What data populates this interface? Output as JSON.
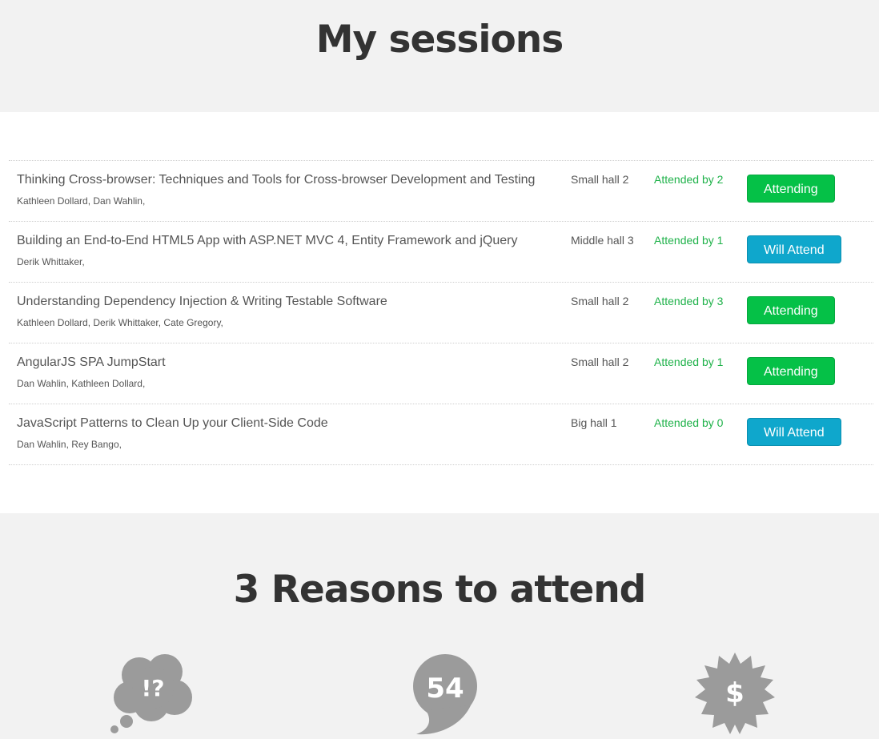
{
  "header": {
    "title": "My sessions"
  },
  "sessions": [
    {
      "title": "Thinking Cross-browser: Techniques and Tools for Cross-browser Development and Testing",
      "speakers": "Kathleen Dollard, Dan Wahlin,",
      "hall": "Small hall 2",
      "attendees": "Attended by 2",
      "button": "Attending",
      "status": "attending"
    },
    {
      "title": "Building an End-to-End HTML5 App with ASP.NET MVC 4, Entity Framework and jQuery",
      "speakers": "Derik Whittaker,",
      "hall": "Middle hall 3",
      "attendees": "Attended by 1",
      "button": "Will Attend",
      "status": "will-attend"
    },
    {
      "title": "Understanding Dependency Injection & Writing Testable Software",
      "speakers": "Kathleen Dollard, Derik Whittaker, Cate Gregory,",
      "hall": "Small hall 2",
      "attendees": "Attended by 3",
      "button": "Attending",
      "status": "attending"
    },
    {
      "title": "AngularJS SPA JumpStart",
      "speakers": "Dan Wahlin, Kathleen Dollard,",
      "hall": "Small hall 2",
      "attendees": "Attended by 1",
      "button": "Attending",
      "status": "attending"
    },
    {
      "title": "JavaScript Patterns to Clean Up your Client-Side Code",
      "speakers": "Dan Wahlin, Rey Bango,",
      "hall": "Big hall 1",
      "attendees": "Attended by 0",
      "button": "Will Attend",
      "status": "will-attend"
    }
  ],
  "reasons": {
    "title": "3 Reasons to attend",
    "icons": [
      {
        "icon": "thought-bubble-icon",
        "text": "!?"
      },
      {
        "icon": "speech-bubble-icon",
        "text": "54"
      },
      {
        "icon": "price-badge-icon",
        "text": "$"
      }
    ]
  },
  "colors": {
    "attending": "#05c147",
    "will_attend": "#0fa7cc",
    "attended_text": "#1fb24a",
    "icon_gray": "#9b9b9b"
  }
}
